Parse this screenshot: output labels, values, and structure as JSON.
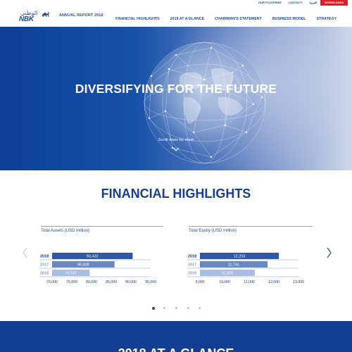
{
  "top_links": {
    "footprint": "OUR FOOTPRINT",
    "contact": "CONTACT",
    "arabic": "العربية",
    "downloads": "DOWNLOADS"
  },
  "header": {
    "logo_text": "NBK",
    "logo_arabic": "الوطني",
    "report_label": "ANNUAL REPORT 2018",
    "nav": [
      "FINANCIAL HIGHLIGHTS",
      "2018 AT A GLANCE",
      "CHAIRMAN'S STATEMENT",
      "BUSINESS MODEL",
      "STRATEGY"
    ]
  },
  "hero": {
    "title": "DIVERSIFYING FOR THE FUTURE",
    "scroll_text": "Scroll down for more"
  },
  "financial": {
    "section_title": "FINANCIAL HIGHLIGHTS"
  },
  "carousel": {
    "slide_count": 5,
    "active_index": 0
  },
  "bottom": {
    "title": "2018 AT A GLANCE"
  },
  "colors": {
    "brand_blue": "#173e8c",
    "bar_2018": "#2c5aa8",
    "bar_2017": "#6688c4",
    "bar_2016": "#a9bde0",
    "download_red": "#d71f2b"
  },
  "chart_data": [
    {
      "type": "bar",
      "orientation": "horizontal",
      "title": "Total Assets (USD million)",
      "categories": [
        "2018",
        "2017",
        "2016"
      ],
      "values": [
        90432,
        85838,
        79537
      ],
      "value_labels": [
        "90,432",
        "85,838",
        "79,537"
      ],
      "xlim": [
        70000,
        95000
      ],
      "xticks": [
        "70,000",
        "75,000",
        "80,000",
        "85,000",
        "90,000",
        "95,000"
      ]
    },
    {
      "type": "bar",
      "orientation": "horizontal",
      "title": "Total Equity (USD million)",
      "categories": [
        "2018",
        "2017",
        "2016"
      ],
      "values": [
        12203,
        11741,
        11226
      ],
      "value_labels": [
        "12,203",
        "11,741",
        "11,226"
      ],
      "xlim": [
        9000,
        13000
      ],
      "xticks": [
        "9,000",
        "10,000",
        "11,000",
        "12,000",
        "13,000"
      ]
    }
  ]
}
